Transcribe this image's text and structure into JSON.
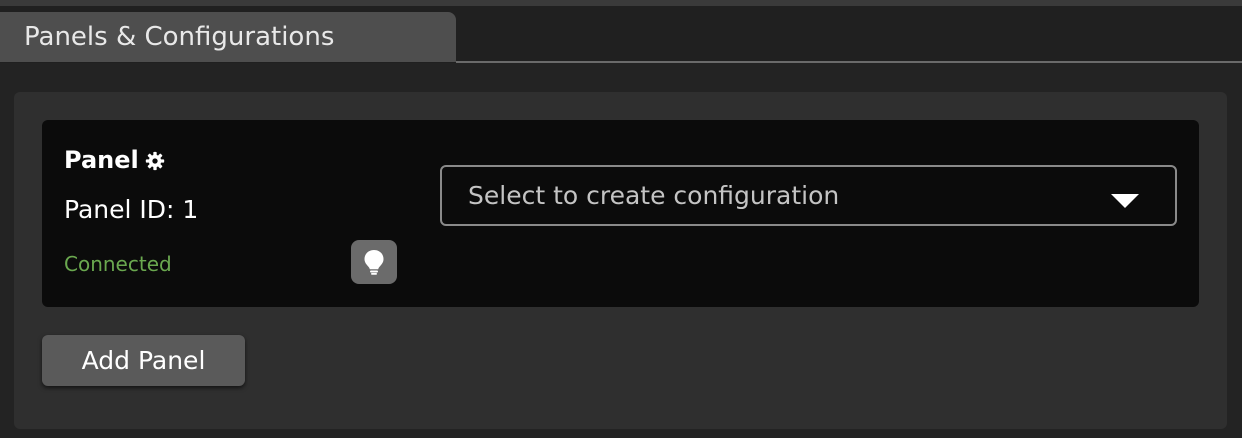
{
  "tab": {
    "label": "Panels & Configurations"
  },
  "panel": {
    "title": "Panel",
    "settings_icon": "gear-icon",
    "id_label": "Panel ID: 1",
    "status": "Connected",
    "status_color": "#6aa84f",
    "identify_icon": "lightbulb-icon"
  },
  "config_select": {
    "placeholder": "Select to create configuration"
  },
  "actions": {
    "add_panel_label": "Add Panel"
  }
}
